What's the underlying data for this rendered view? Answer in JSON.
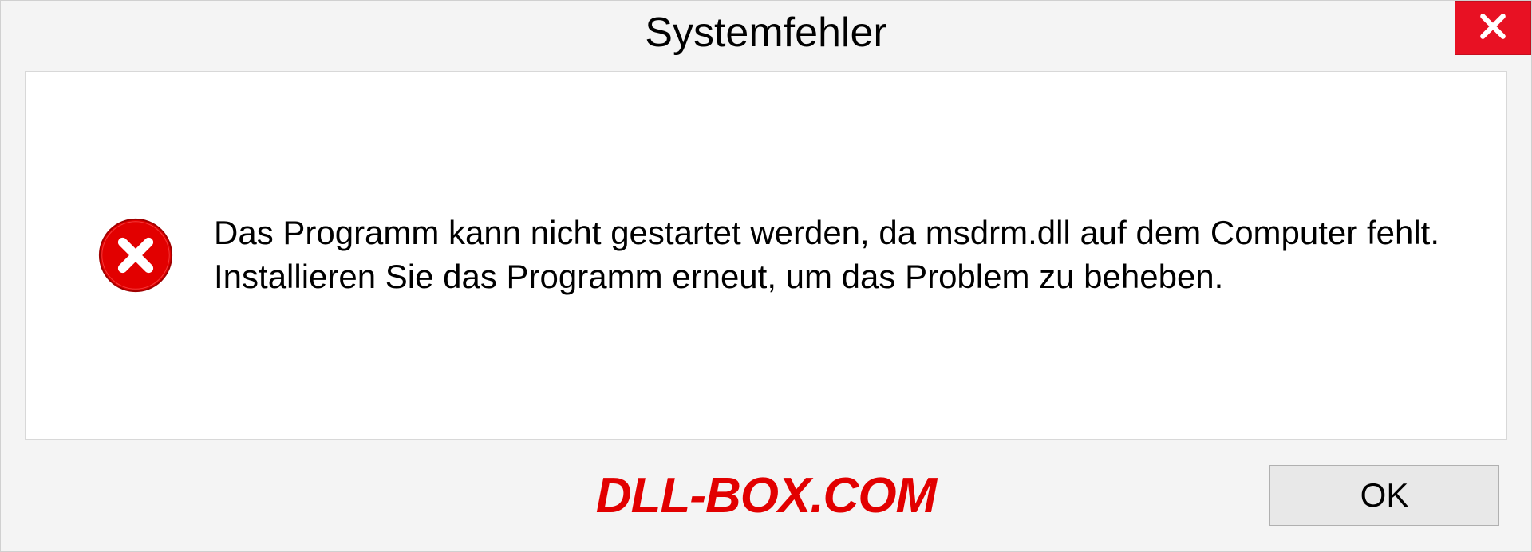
{
  "dialog": {
    "title": "Systemfehler",
    "message": "Das Programm kann nicht gestartet werden, da msdrm.dll auf dem Computer fehlt. Installieren Sie das Programm erneut, um das Problem zu beheben.",
    "ok_label": "OK"
  },
  "watermark": "DLL-BOX.COM"
}
